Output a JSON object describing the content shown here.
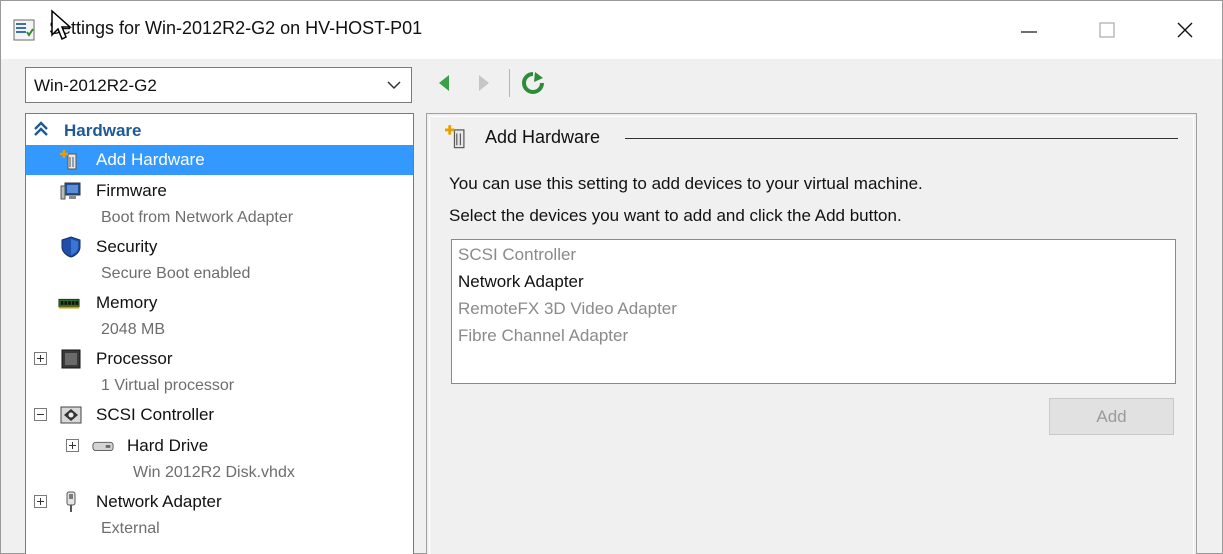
{
  "window": {
    "title": "Settings for Win-2012R2-G2 on HV-HOST-P01",
    "app_icon": "settings-icon",
    "controls": [
      "minimize-icon",
      "maximize-icon",
      "close-icon"
    ]
  },
  "vm_selector": {
    "selected": "Win-2012R2-G2"
  },
  "toolbar": {
    "icons": [
      "back-arrow-icon",
      "forward-arrow-icon",
      "refresh-icon"
    ]
  },
  "sidebar": {
    "section": "Hardware",
    "items": [
      {
        "label": "Add Hardware",
        "sub": "",
        "icon": "add-hardware-icon"
      },
      {
        "label": "Firmware",
        "sub": "Boot from Network Adapter",
        "icon": "firmware-icon"
      },
      {
        "label": "Security",
        "sub": "Secure Boot enabled",
        "icon": "shield-icon"
      },
      {
        "label": "Memory",
        "sub": "2048 MB",
        "icon": "memory-icon"
      },
      {
        "label": "Processor",
        "sub": "1 Virtual processor",
        "icon": "processor-icon"
      },
      {
        "label": "SCSI Controller",
        "sub": "",
        "icon": "scsi-controller-icon"
      },
      {
        "label": "Hard Drive",
        "sub": "Win 2012R2 Disk.vhdx",
        "icon": "hard-drive-icon"
      },
      {
        "label": "Network Adapter",
        "sub": "External",
        "icon": "network-adapter-icon"
      }
    ]
  },
  "main": {
    "header": "Add Hardware",
    "description1": "You can use this setting to add devices to your virtual machine.",
    "description2": "Select the devices you want to add and click the Add button.",
    "devices": [
      {
        "label": "SCSI Controller",
        "enabled": false
      },
      {
        "label": "Network Adapter",
        "enabled": true
      },
      {
        "label": "RemoteFX 3D Video Adapter",
        "enabled": false
      },
      {
        "label": "Fibre Channel Adapter",
        "enabled": false
      }
    ],
    "add_button": "Add"
  },
  "colors": {
    "selection": "#3399ff",
    "section_header": "#1d5a96",
    "disabled_text": "#8a8a8a",
    "nav_green": "#3aa04a"
  }
}
